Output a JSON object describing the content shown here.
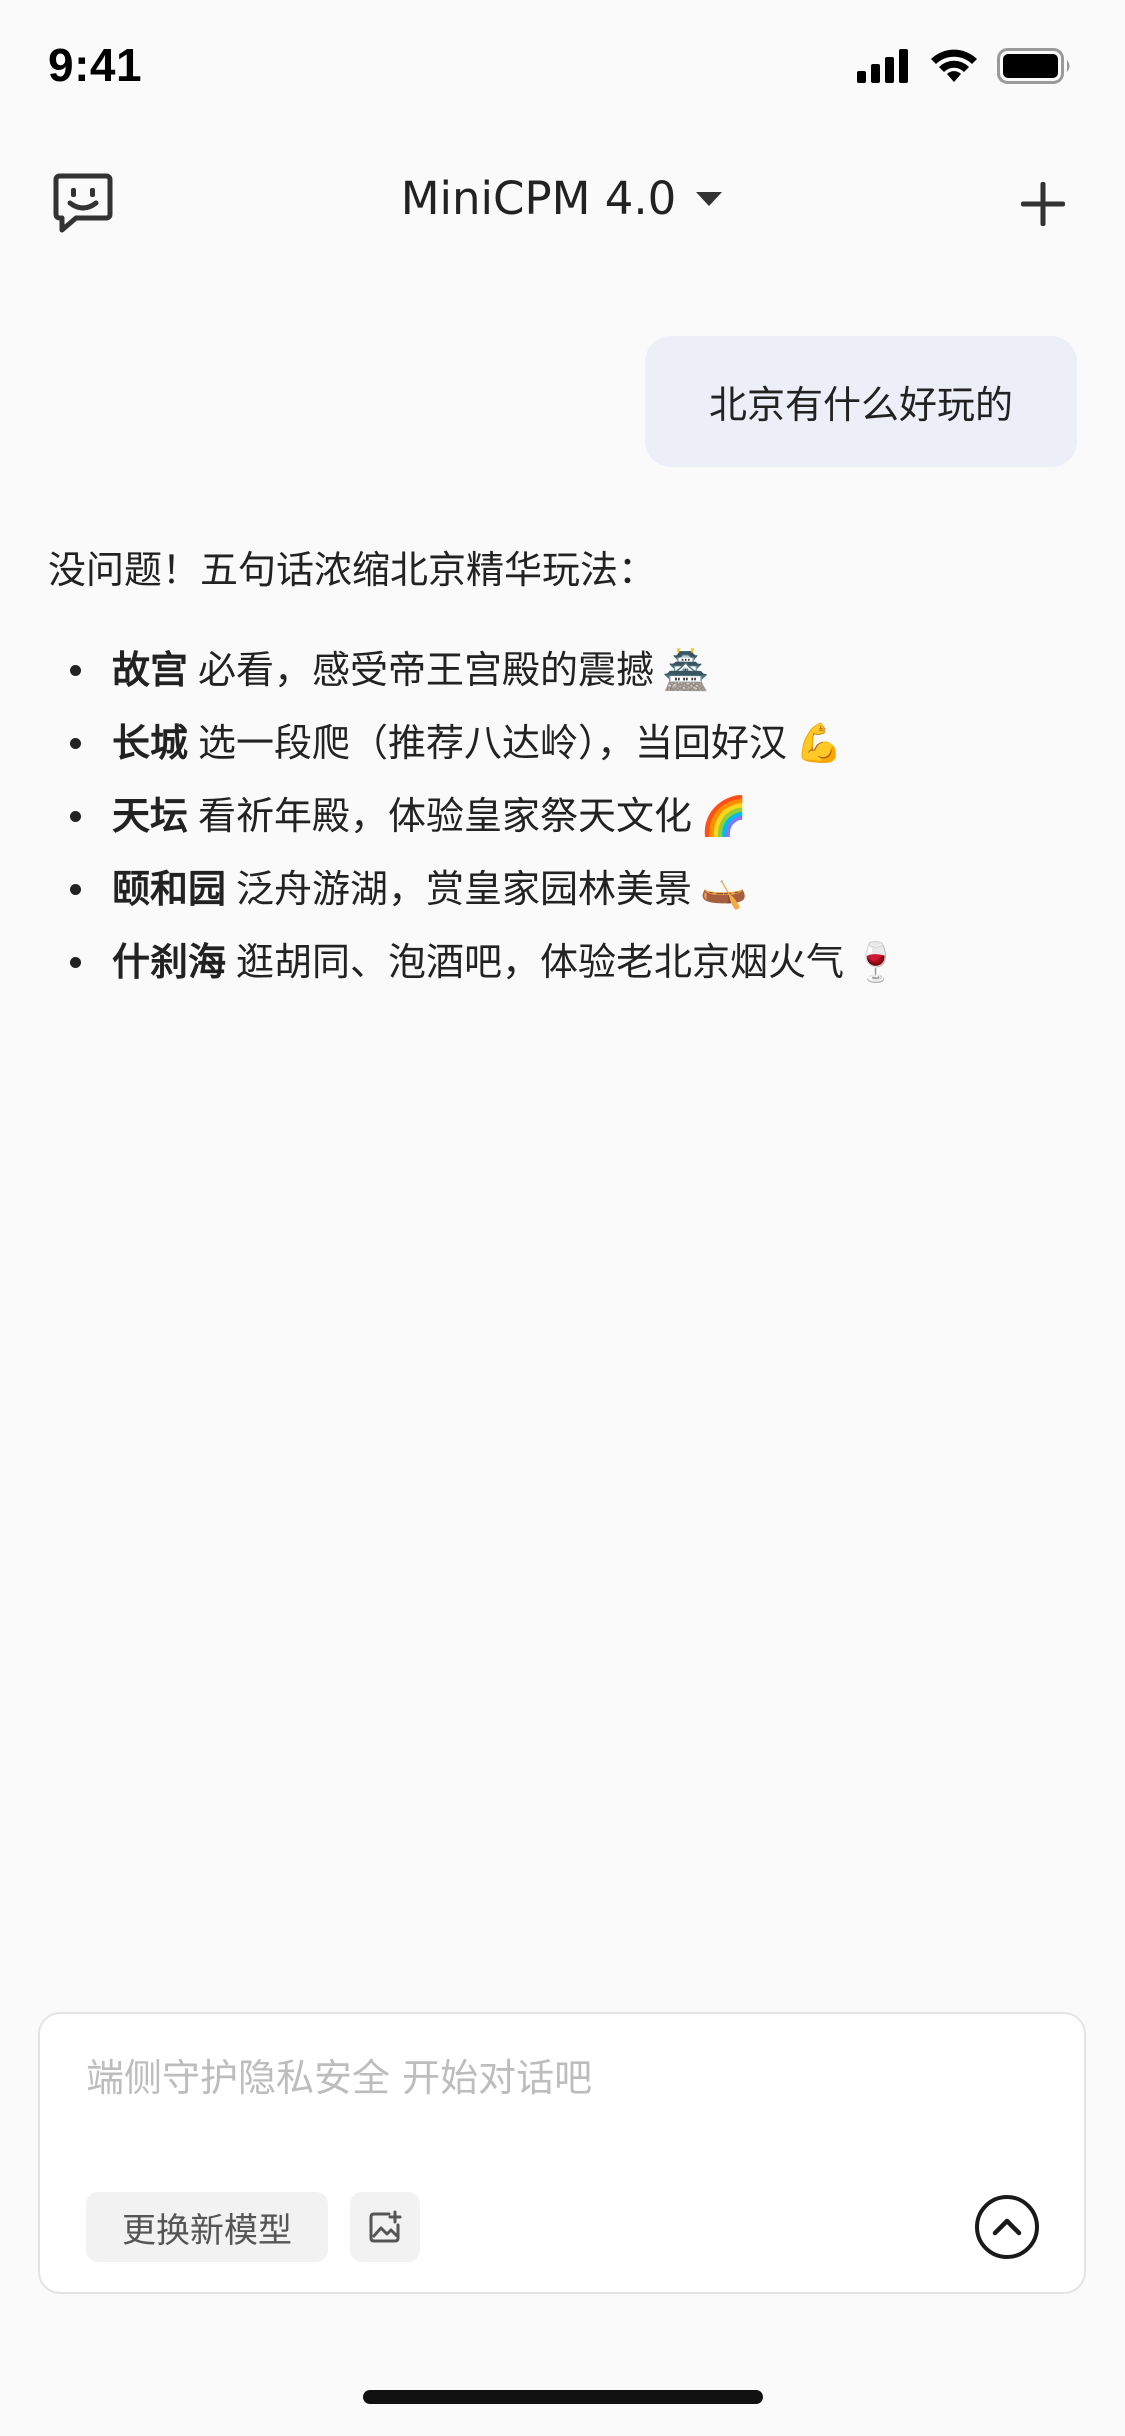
{
  "status_bar": {
    "time": "9:41",
    "icons": [
      "cellular-signal-icon",
      "wifi-icon",
      "battery-icon"
    ]
  },
  "header": {
    "left_icon": "chat-face-icon",
    "title": "MiniCPM 4.0",
    "dropdown_icon": "caret-down-icon",
    "right_icon": "plus-icon"
  },
  "conversation": {
    "user_message": "北京有什么好玩的",
    "assistant": {
      "intro": "没问题！五句话浓缩北京精华玩法：",
      "items": [
        {
          "bold": "故宫",
          "text": "必看，感受帝王宫殿的震撼",
          "emoji": "🏯"
        },
        {
          "bold": "长城",
          "text": "选一段爬（推荐八达岭），当回好汉",
          "emoji": "💪"
        },
        {
          "bold": "天坛",
          "text": "看祈年殿，体验皇家祭天文化",
          "emoji": "🌈"
        },
        {
          "bold": "颐和园",
          "text": "泛舟游湖，赏皇家园林美景",
          "emoji": "🛶"
        },
        {
          "bold": "什刹海",
          "text": "逛胡同、泡酒吧，体验老北京烟火气",
          "emoji": "🍷"
        }
      ]
    }
  },
  "composer": {
    "placeholder": "端侧守护隐私安全 开始对话吧",
    "value": "",
    "model_button_label": "更换新模型",
    "image_button_icon": "image-add-icon",
    "send_button_icon": "arrow-up-circle-icon"
  },
  "colors": {
    "background": "#fafafa",
    "user_bubble": "#eceef8",
    "text": "#222222",
    "placeholder": "#bdbdbd"
  }
}
